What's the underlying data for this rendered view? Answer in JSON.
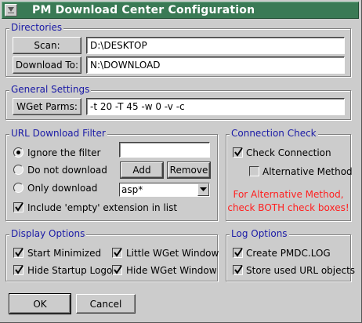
{
  "window": {
    "title": "PM Download Center Configuration"
  },
  "directories": {
    "legend": "Directories",
    "scan_label": "Scan:",
    "scan_value": "D:\\DESKTOP",
    "download_label": "Download To:",
    "download_value": "N:\\DOWNLOAD"
  },
  "general": {
    "legend": "General Settings",
    "wget_label": "WGet Parms:",
    "wget_value": "-t 20 -T 45 -w 0 -v -c"
  },
  "url_filter": {
    "legend": "URL Download Filter",
    "options": [
      {
        "label": "Ignore the filter",
        "selected": true
      },
      {
        "label": "Do not download",
        "selected": false
      },
      {
        "label": "Only download",
        "selected": false
      }
    ],
    "filter_input_value": "",
    "add_label": "Add",
    "remove_label": "Remove",
    "combo_value": "asp*",
    "include_empty_label": "Include 'empty' extension in list",
    "include_empty_checked": true
  },
  "connection": {
    "legend": "Connection Check",
    "check_label": "Check Connection",
    "check_checked": true,
    "alt_label": "Alternative Method",
    "alt_checked": false,
    "warning_line1": "For Alternative Method,",
    "warning_line2": "check BOTH check boxes!",
    "warning_color": "#ff2020"
  },
  "display": {
    "legend": "Display Options",
    "start_min_label": "Start Minimized",
    "start_min_checked": true,
    "little_wget_label": "Little WGet Window",
    "little_wget_checked": true,
    "hide_logo_label": "Hide Startup Logo",
    "hide_logo_checked": true,
    "hide_wget_label": "Hide WGet Window",
    "hide_wget_checked": true
  },
  "log": {
    "legend": "Log Options",
    "create_label": "Create PMDC.LOG",
    "create_checked": true,
    "store_label": "Store used URL objects",
    "store_checked": true
  },
  "footer": {
    "ok_label": "OK",
    "cancel_label": "Cancel"
  },
  "colors": {
    "titlebar": "#3a7a55",
    "legend": "#1a1aa6",
    "face": "#cccccc"
  }
}
